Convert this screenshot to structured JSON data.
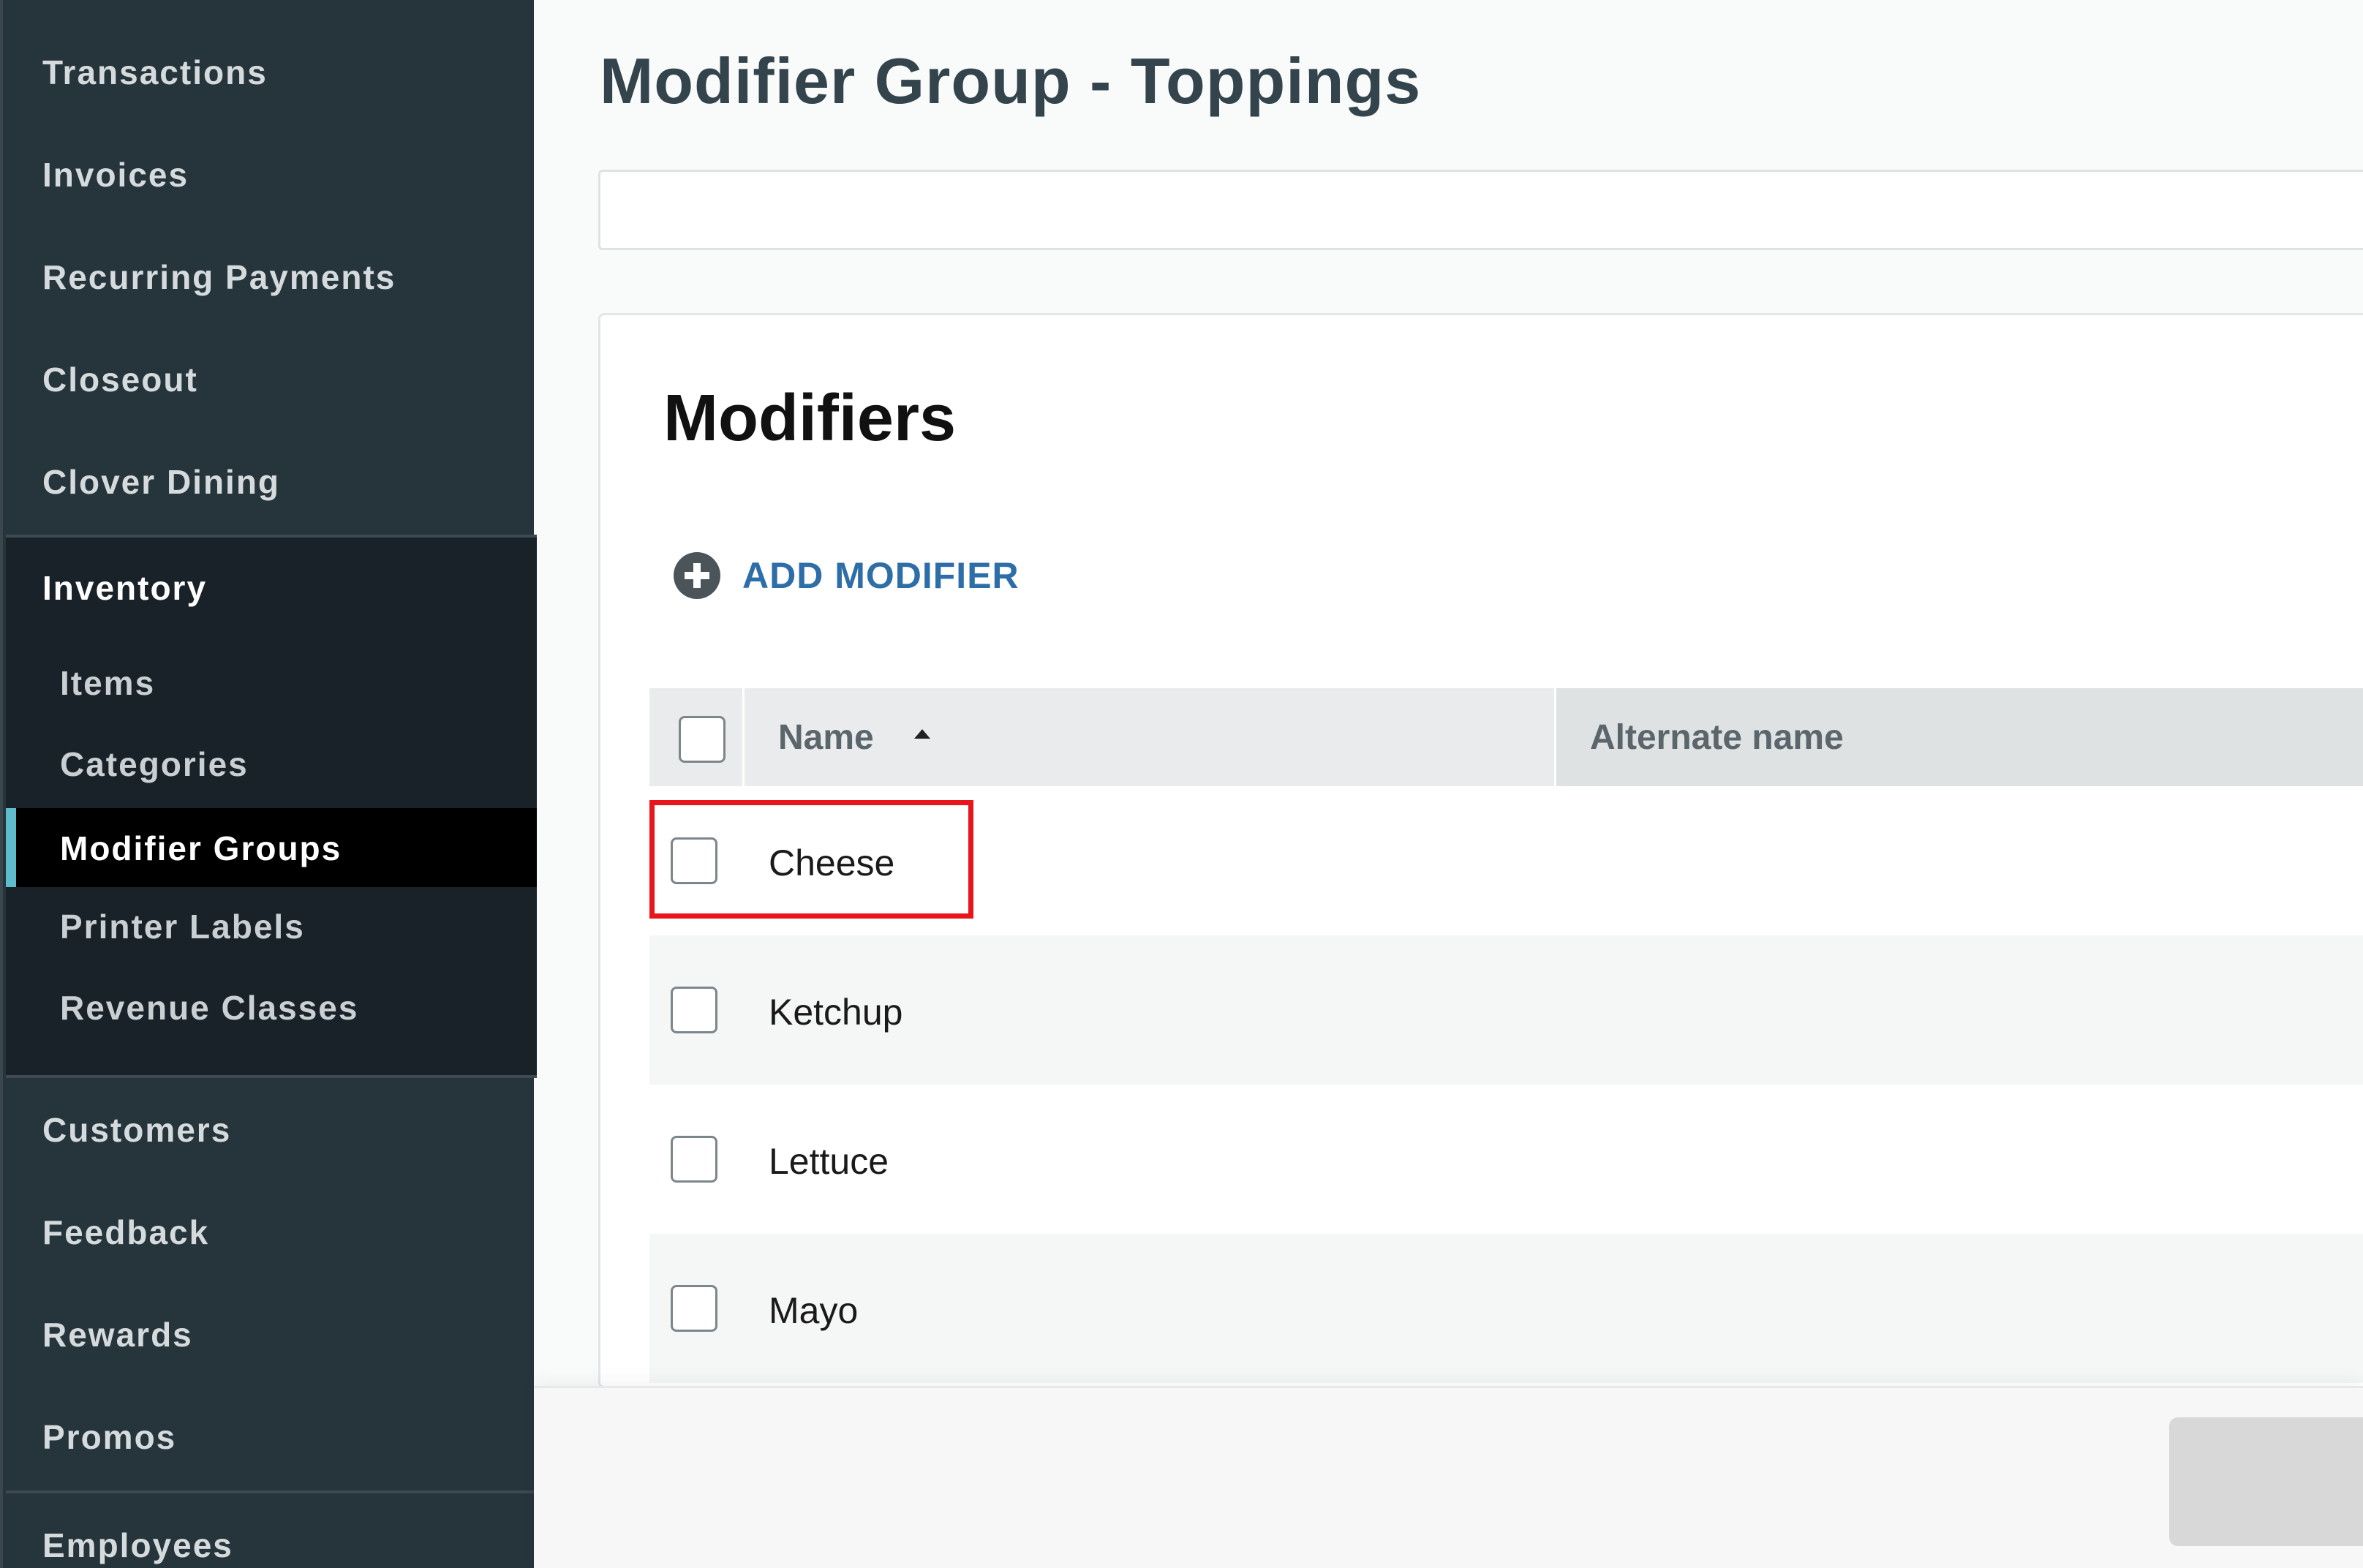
{
  "sidebar": {
    "top_items": [
      {
        "label": "Transactions"
      },
      {
        "label": "Invoices"
      },
      {
        "label": "Recurring Payments"
      },
      {
        "label": "Closeout"
      },
      {
        "label": "Clover Dining"
      }
    ],
    "inventory": {
      "title": "Inventory",
      "items": [
        {
          "label": "Items"
        },
        {
          "label": "Categories"
        },
        {
          "label": "Modifier Groups",
          "active": true
        },
        {
          "label": "Printer Labels"
        },
        {
          "label": "Revenue Classes"
        }
      ]
    },
    "bottom_items": [
      {
        "label": "Customers"
      },
      {
        "label": "Feedback"
      },
      {
        "label": "Rewards"
      },
      {
        "label": "Promos"
      },
      {
        "label": "Employees"
      }
    ],
    "active_accent_color": "#5fbccd"
  },
  "main": {
    "page_title": "Modifier Group - Toppings",
    "card": {
      "title": "Modifiers",
      "add_button": {
        "label": "ADD MODIFIER",
        "icon": "plus-circle-icon"
      },
      "table": {
        "columns": [
          {
            "label": "Name",
            "sort": "ascending"
          },
          {
            "label": "Alternate name"
          }
        ],
        "rows": [
          {
            "name": "Cheese",
            "alternate_name": "",
            "checked": false,
            "highlighted": true
          },
          {
            "name": "Ketchup",
            "alternate_name": "",
            "checked": false
          },
          {
            "name": "Lettuce",
            "alternate_name": "",
            "checked": false
          },
          {
            "name": "Mayo",
            "alternate_name": "",
            "checked": false
          }
        ]
      }
    }
  },
  "colors": {
    "link_blue": "#2e6ea8",
    "highlight_red": "#e8151c",
    "sidebar_bg": "#26343b"
  }
}
